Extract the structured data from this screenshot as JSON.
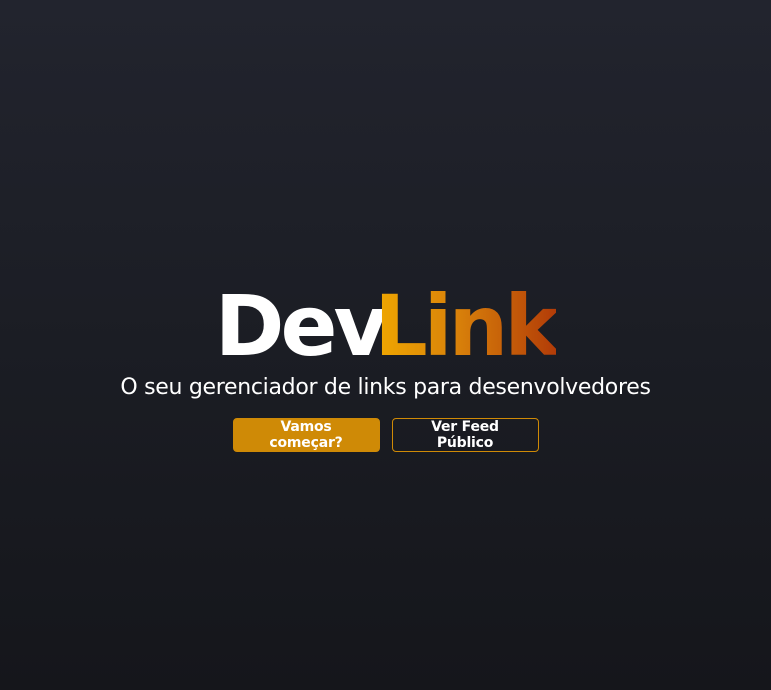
{
  "hero": {
    "logo_part_1": "Dev",
    "logo_part_2": "Link",
    "subtitle": "O seu gerenciador de links para desenvolvedores"
  },
  "actions": {
    "start_label": "Vamos começar?",
    "feed_label": "Ver Feed Público"
  },
  "colors": {
    "background": "#1c1e25",
    "accent": "#cf8a06",
    "gradient_start": "#f0a800",
    "gradient_end": "#b23c08"
  }
}
